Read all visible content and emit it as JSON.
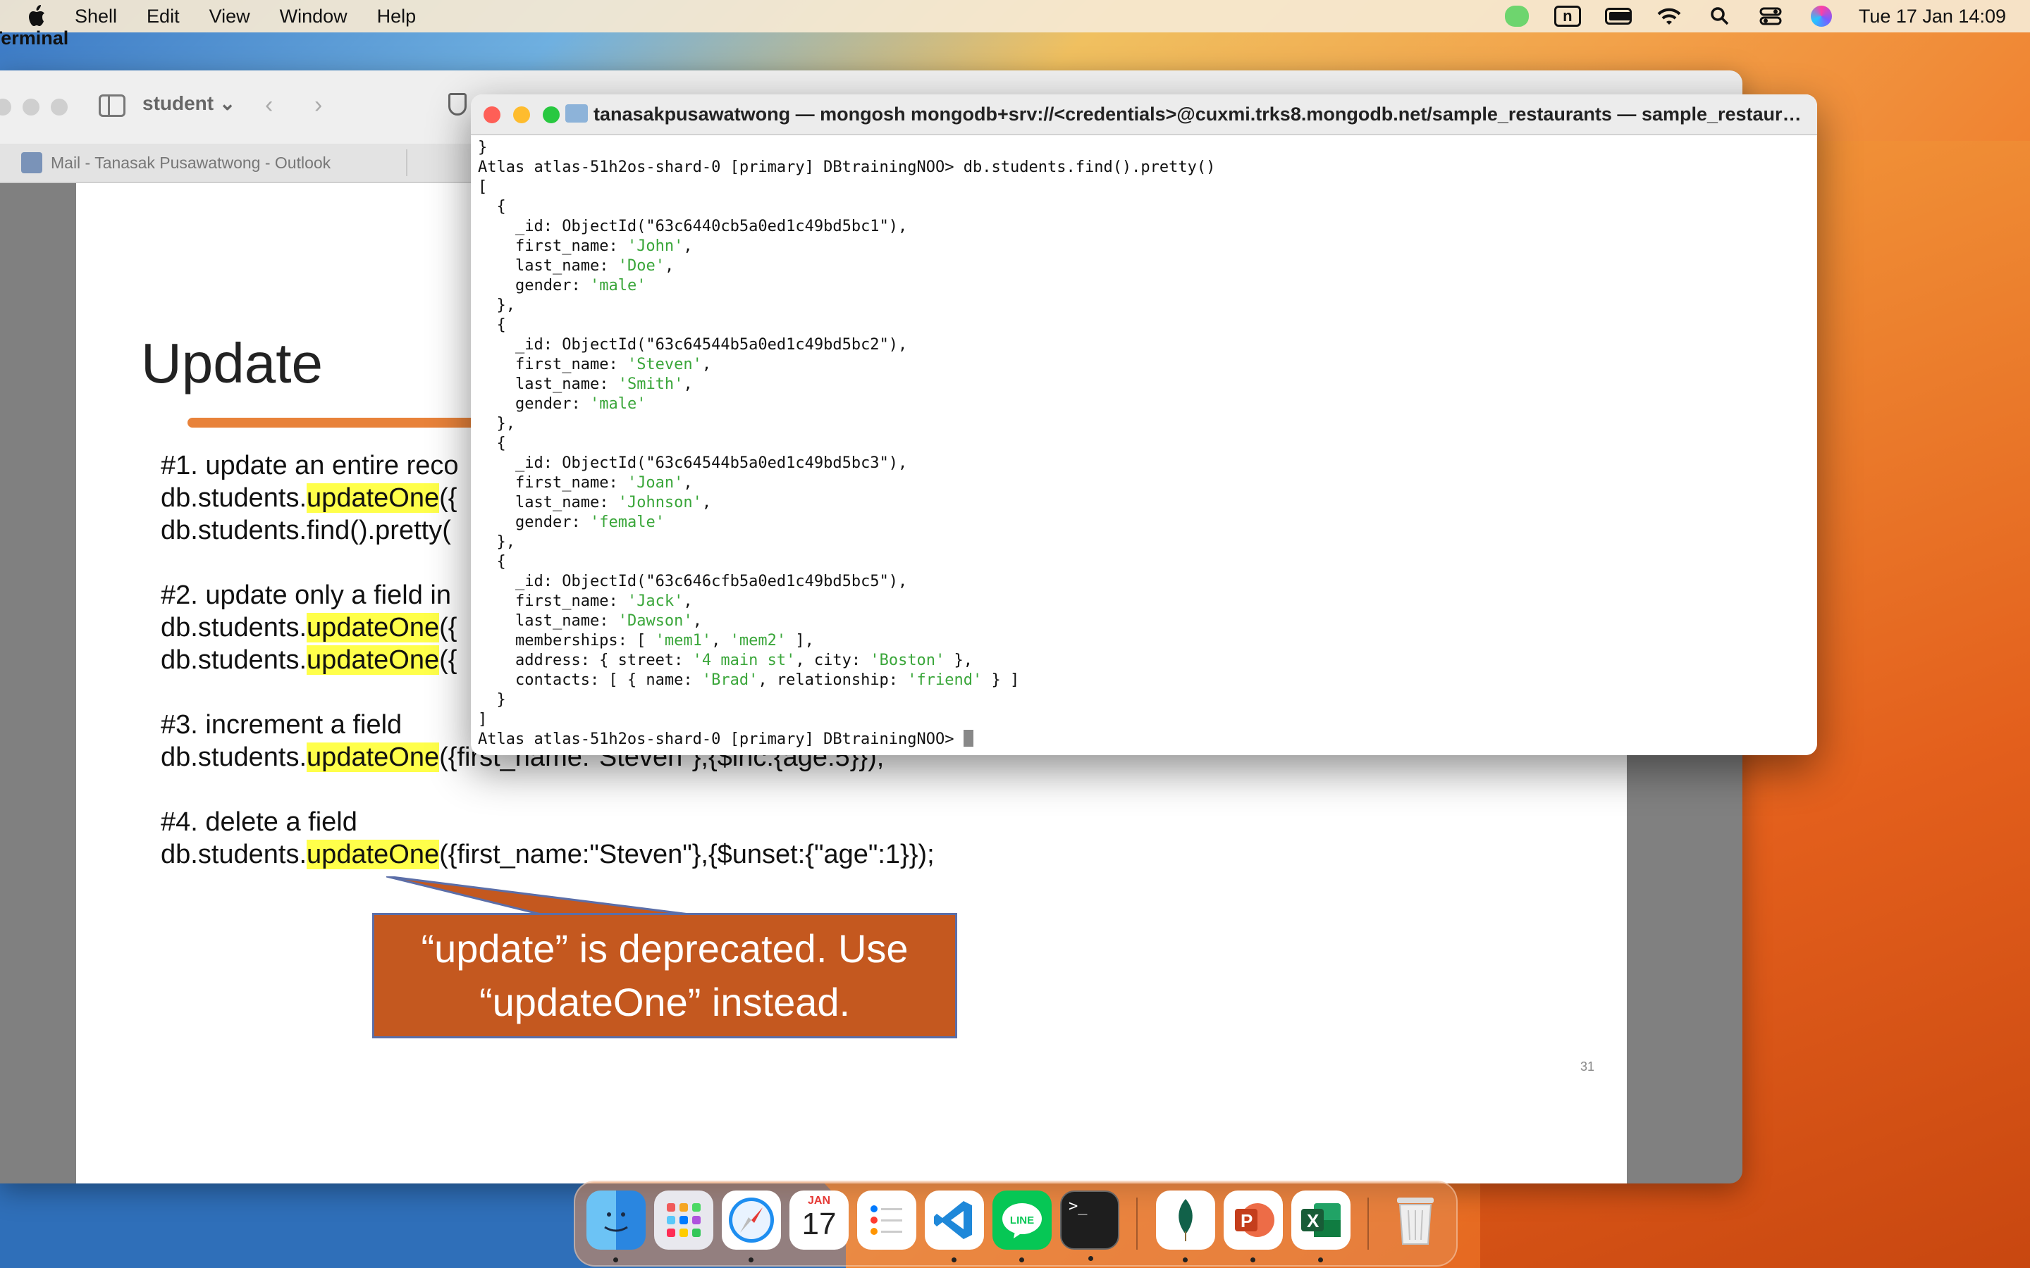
{
  "menubar": {
    "app_name": "Terminal",
    "items": [
      "Shell",
      "Edit",
      "View",
      "Window",
      "Help"
    ],
    "datetime": "Tue 17 Jan  14:09",
    "n_badge": "n"
  },
  "browser": {
    "profile": "student",
    "tab_title": "Mail - Tanasak Pusawatwong - Outlook"
  },
  "slide": {
    "title": "Update",
    "items": [
      {
        "heading": "#1. update an entire reco",
        "lines": [
          [
            "db.students.",
            "updateOne",
            "({"
          ],
          [
            "db.students.find().pretty(",
            "",
            ""
          ]
        ]
      },
      {
        "heading": "#2. update only a field in",
        "lines": [
          [
            "db.students.",
            "updateOne",
            "({"
          ],
          [
            "db.students.",
            "updateOne",
            "({"
          ]
        ]
      },
      {
        "heading": "#3. increment a field",
        "lines": [
          [
            "db.students.",
            "updateOne",
            "({first_name:\"Steven\"},{$inc:{age:5}});"
          ]
        ]
      },
      {
        "heading": "#4. delete a field",
        "lines": [
          [
            "db.students.",
            "updateOne",
            "({first_name:\"Steven\"},{$unset:{\"age\":1}});"
          ]
        ]
      }
    ],
    "callout_line1": "“update” is deprecated. Use",
    "callout_line2": "“updateOne” instead.",
    "page_number": "31"
  },
  "terminal": {
    "title": "tanasakpusawatwong — mongosh mongodb+srv://<credentials>@cuxmi.trks8.mongodb.net/sample_restaurants — sample_restauran...",
    "prompt": "Atlas atlas-51h2os-shard-0 [primary] DBtrainingNOO>",
    "command": "db.students.find().pretty()",
    "documents": [
      {
        "id": "63c6440cb5a0ed1c49bd5bc1",
        "fields": [
          [
            "first_name",
            "John"
          ],
          [
            "last_name",
            "Doe"
          ],
          [
            "gender",
            "male"
          ]
        ]
      },
      {
        "id": "63c64544b5a0ed1c49bd5bc2",
        "fields": [
          [
            "first_name",
            "Steven"
          ],
          [
            "last_name",
            "Smith"
          ],
          [
            "gender",
            "male"
          ]
        ]
      },
      {
        "id": "63c64544b5a0ed1c49bd5bc3",
        "fields": [
          [
            "first_name",
            "Joan"
          ],
          [
            "last_name",
            "Johnson"
          ],
          [
            "gender",
            "female"
          ]
        ]
      },
      {
        "id": "63c646cfb5a0ed1c49bd5bc5",
        "fields": [
          [
            "first_name",
            "Jack"
          ],
          [
            "last_name",
            "Dawson"
          ]
        ],
        "memberships": [
          "mem1",
          "mem2"
        ],
        "address": {
          "street": "4 main st",
          "city": "Boston"
        },
        "contacts": [
          {
            "name": "Brad",
            "relationship": "friend"
          }
        ]
      }
    ]
  },
  "dock": {
    "calendar_month": "JAN",
    "calendar_day": "17",
    "line_label": "LINE",
    "apps": [
      "finder",
      "launchpad",
      "safari",
      "calendar",
      "reminders",
      "vscode",
      "line",
      "terminal",
      "mongodb-compass",
      "powerpoint",
      "excel",
      "trash"
    ]
  }
}
